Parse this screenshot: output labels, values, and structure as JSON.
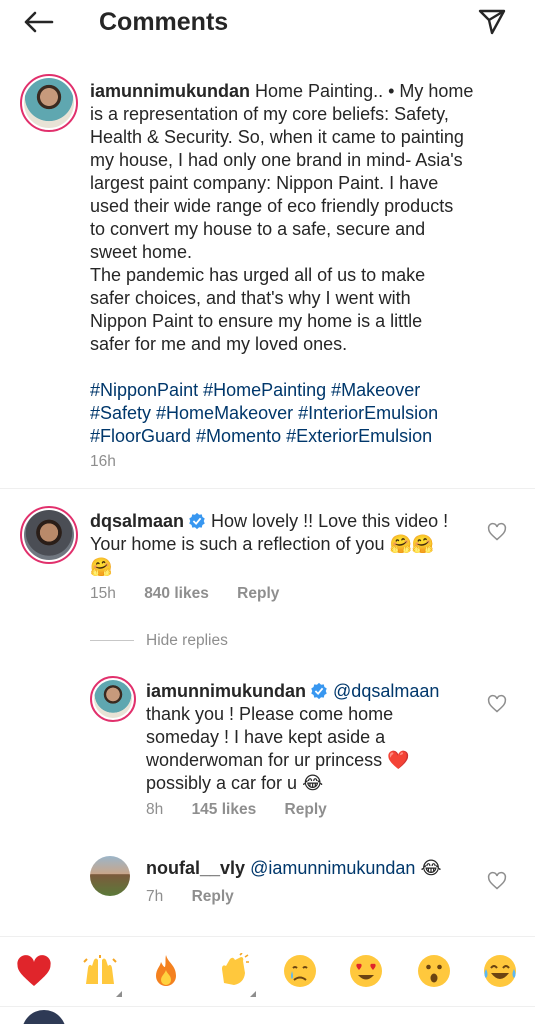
{
  "header": {
    "title": "Comments",
    "back_icon": "arrow-left-icon",
    "send_icon": "paper-plane-icon"
  },
  "caption": {
    "username": "iamunnimukundan",
    "lines": [
      " Home Painting.. • My home",
      "is a representation of my core beliefs: Safety,",
      "Health & Security. So, when it came to painting",
      "my house, I had only one brand in mind- Asia's",
      "largest paint company: Nippon Paint.  I have",
      "used their wide range of eco friendly products",
      "to convert my house to a safe, secure and",
      "sweet home.",
      "The pandemic has urged all of us to make",
      "safer choices, and that's why I went with",
      "Nippon Paint to ensure my home is a little",
      "safer for me and my loved ones."
    ],
    "hashtag_lines": [
      "#NipponPaint #HomePainting #Makeover",
      "#Safety #HomeMakeover #InteriorEmulsion",
      "#FloorGuard #Momento #ExteriorEmulsion"
    ],
    "time": "16h"
  },
  "comments": [
    {
      "username": "dqsalmaan",
      "line1": " How lovely !! Love this video !",
      "line2": "Your home is such a reflection of you 🤗🤗",
      "line3": "🤗",
      "time": "15h",
      "likes": "840 likes",
      "reply": "Reply"
    }
  ],
  "hide_replies": "Hide replies",
  "replies": [
    {
      "username": "iamunnimukundan",
      "mention": "@dqsalmaan",
      "lines": [
        "thank you ! Please come home",
        "someday ! I have kept aside a",
        "wonderwoman for ur princess ❤️",
        "possibly a car for u 😂"
      ],
      "time": "8h",
      "likes": "145 likes",
      "reply": "Reply"
    },
    {
      "username": "noufal__vly",
      "mention": "@iamunnimukundan",
      "emoji": "😂",
      "time": "7h",
      "reply": "Reply"
    }
  ],
  "quick_emojis": [
    "❤️",
    "🙌",
    "🔥",
    "👏",
    "😢",
    "😍",
    "😮",
    "😂"
  ]
}
